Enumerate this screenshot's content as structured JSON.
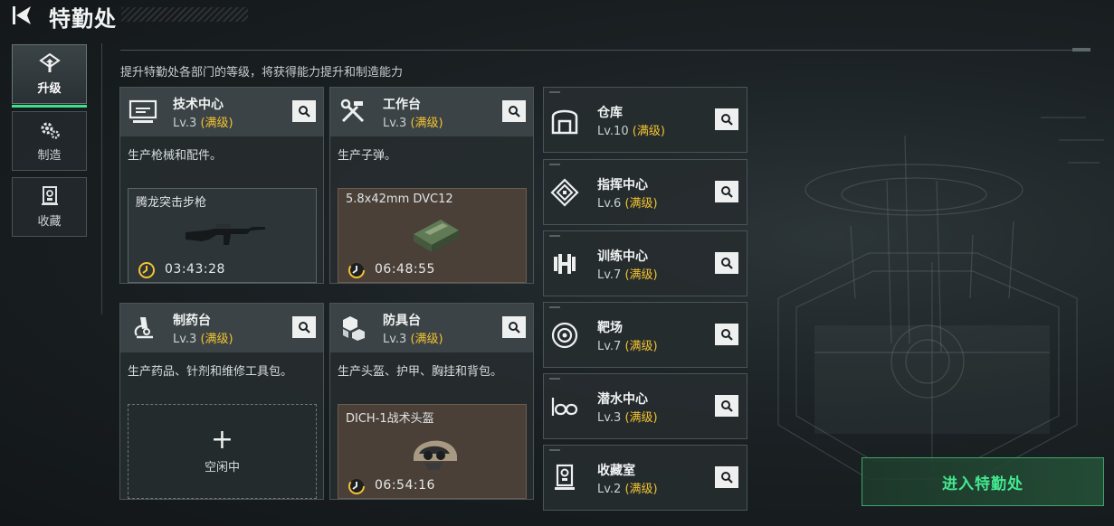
{
  "header": {
    "title": "特勤处"
  },
  "nav": [
    {
      "label": "升级",
      "icon": "upgrade-icon",
      "active": true
    },
    {
      "label": "制造",
      "icon": "gears-icon",
      "active": false
    },
    {
      "label": "收藏",
      "icon": "collection-icon",
      "active": false
    }
  ],
  "subtitle": "提升特勤处各部门的等级，将获得能力提升和制造能力",
  "cards": [
    {
      "name": "技术中心",
      "level": "Lv.3",
      "status": "(满级)",
      "desc": "生产枪械和配件。",
      "production": {
        "item": "腾龙突击步枪",
        "time": "03:43:28"
      }
    },
    {
      "name": "工作台",
      "level": "Lv.3",
      "status": "(满级)",
      "desc": "生产子弹。",
      "production": {
        "item": "5.8x42mm DVC12",
        "time": "06:48:55"
      }
    },
    {
      "name": "制药台",
      "level": "Lv.3",
      "status": "(满级)",
      "desc": "生产药品、针剂和维修工具包。",
      "idle": {
        "plus": "+",
        "label": "空闲中"
      }
    },
    {
      "name": "防具台",
      "level": "Lv.3",
      "status": "(满级)",
      "desc": "生产头盔、护甲、胸挂和背包。",
      "production": {
        "item": "DICH-1战术头盔",
        "time": "06:54:16"
      }
    }
  ],
  "facilities": [
    {
      "name": "仓库",
      "level": "Lv.10",
      "status": "(满级)",
      "icon": "warehouse-icon"
    },
    {
      "name": "指挥中心",
      "level": "Lv.6",
      "status": "(满级)",
      "icon": "command-center-icon"
    },
    {
      "name": "训练中心",
      "level": "Lv.7",
      "status": "(满级)",
      "icon": "dumbbell-icon"
    },
    {
      "name": "靶场",
      "level": "Lv.7",
      "status": "(满级)",
      "icon": "target-icon"
    },
    {
      "name": "潜水中心",
      "level": "Lv.3",
      "status": "(满级)",
      "icon": "diving-goggles-icon"
    },
    {
      "name": "收藏室",
      "level": "Lv.2",
      "status": "(满级)",
      "icon": "trophy-case-icon"
    }
  ],
  "enter_button": "进入特勤处",
  "colors": {
    "accent_green": "#44e890",
    "max_level_yellow": "#f2c230",
    "panel": "#262c2f"
  }
}
